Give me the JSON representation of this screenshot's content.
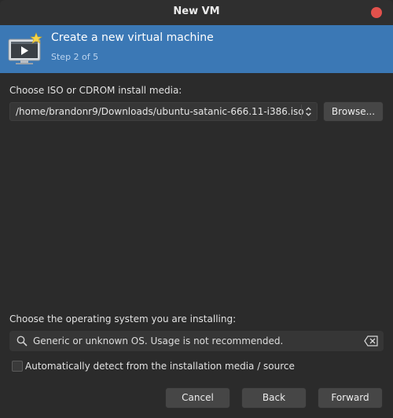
{
  "window": {
    "title": "New VM"
  },
  "banner": {
    "title": "Create a new virtual machine",
    "step": "Step 2 of 5"
  },
  "install_media": {
    "label": "Choose ISO or CDROM install media:",
    "value": "/home/brandonr9/Downloads/ubuntu-satanic-666.11-i386.iso",
    "browse_label": "Browse..."
  },
  "os": {
    "label": "Choose the operating system you are installing:",
    "search_value": "Generic or unknown OS. Usage is not recommended.",
    "auto_detect_label": "Automatically detect from the installation media / source",
    "auto_detect_checked": false
  },
  "footer": {
    "cancel_label": "Cancel",
    "back_label": "Back",
    "forward_label": "Forward"
  },
  "colors": {
    "banner": "#3b78b5",
    "close": "#e2514c",
    "background": "#2b2b2b"
  },
  "icons": {
    "banner": "vm-monitor-star-icon",
    "spin": "up-down-spinner-icon",
    "search": "search-icon",
    "clear": "clear-text-icon"
  }
}
